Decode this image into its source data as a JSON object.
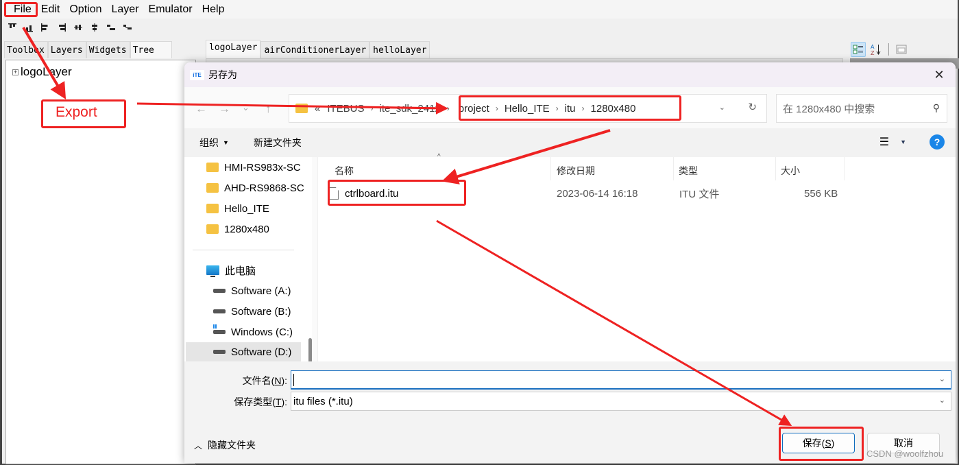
{
  "app": {
    "menu": [
      "File",
      "Edit",
      "Option",
      "Layer",
      "Emulator",
      "Help"
    ],
    "toolbar_icons": [
      "align-top-icon",
      "align-bottom-icon",
      "align-left-icon",
      "align-right-icon",
      "align-center-vertical-icon",
      "align-center-horizontal-icon",
      "distribute-horizontal-icon",
      "distribute-vertical-icon"
    ],
    "left_tabs": [
      "Toolbox",
      "Layers",
      "Widgets",
      "Tree"
    ],
    "active_left_tab": "Tree",
    "tree": [
      {
        "label": "logoLayer",
        "expander": "+"
      }
    ],
    "doc_tabs": [
      "logoLayer",
      "airConditionerLayer",
      "helloLayer"
    ],
    "active_doc_tab": "logoLayer",
    "property_toolbar": [
      "categorized-icon",
      "alphabetical-sort-icon",
      "property-pages-icon"
    ]
  },
  "dialog": {
    "logo": "iTE",
    "title": "另存为",
    "close": "✕",
    "nav": {
      "back": "←",
      "forward": "→",
      "recent": "⌄",
      "up": "↑"
    },
    "breadcrumb_hidden": [
      "«",
      "ITEBUS",
      "ite_sdk_2412"
    ],
    "breadcrumb": [
      "project",
      "Hello_ITE",
      "itu",
      "1280x480"
    ],
    "search_placeholder": "在 1280x480 中搜索",
    "commands": {
      "organize": "组织",
      "new_folder": "新建文件夹"
    },
    "sidebar": {
      "folders": [
        "HMI-RS983x-SC",
        "AHD-RS9868-SC",
        "Hello_ITE",
        "1280x480"
      ],
      "this_pc": "此电脑",
      "drives": [
        {
          "label": "Software (A:)",
          "type": "drive"
        },
        {
          "label": "Software (B:)",
          "type": "drive"
        },
        {
          "label": "Windows (C:)",
          "type": "windows-drive"
        },
        {
          "label": "Software (D:)",
          "type": "drive",
          "selected": true
        }
      ]
    },
    "columns": [
      "名称",
      "修改日期",
      "类型",
      "大小"
    ],
    "files": [
      {
        "name": "ctrlboard.itu",
        "modified": "2023-06-14 16:18",
        "type": "ITU 文件",
        "size": "556 KB"
      }
    ],
    "filename_label": "文件名(N):",
    "filename_label_main": "文件名(",
    "filename_label_key": "N",
    "filename_label_end": "):",
    "filename_value": "",
    "filetype_label_main": "保存类型(",
    "filetype_label_key": "T",
    "filetype_label_end": "):",
    "filetype_value": "itu files (*.itu)",
    "hide_folders": "隐藏文件夹",
    "save_main": "保存(",
    "save_key": "S",
    "save_end": ")",
    "cancel": "取消"
  },
  "annotations": {
    "export_label": "Export",
    "color": "#ee2222"
  },
  "watermark": "CSDN @woolfzhou"
}
